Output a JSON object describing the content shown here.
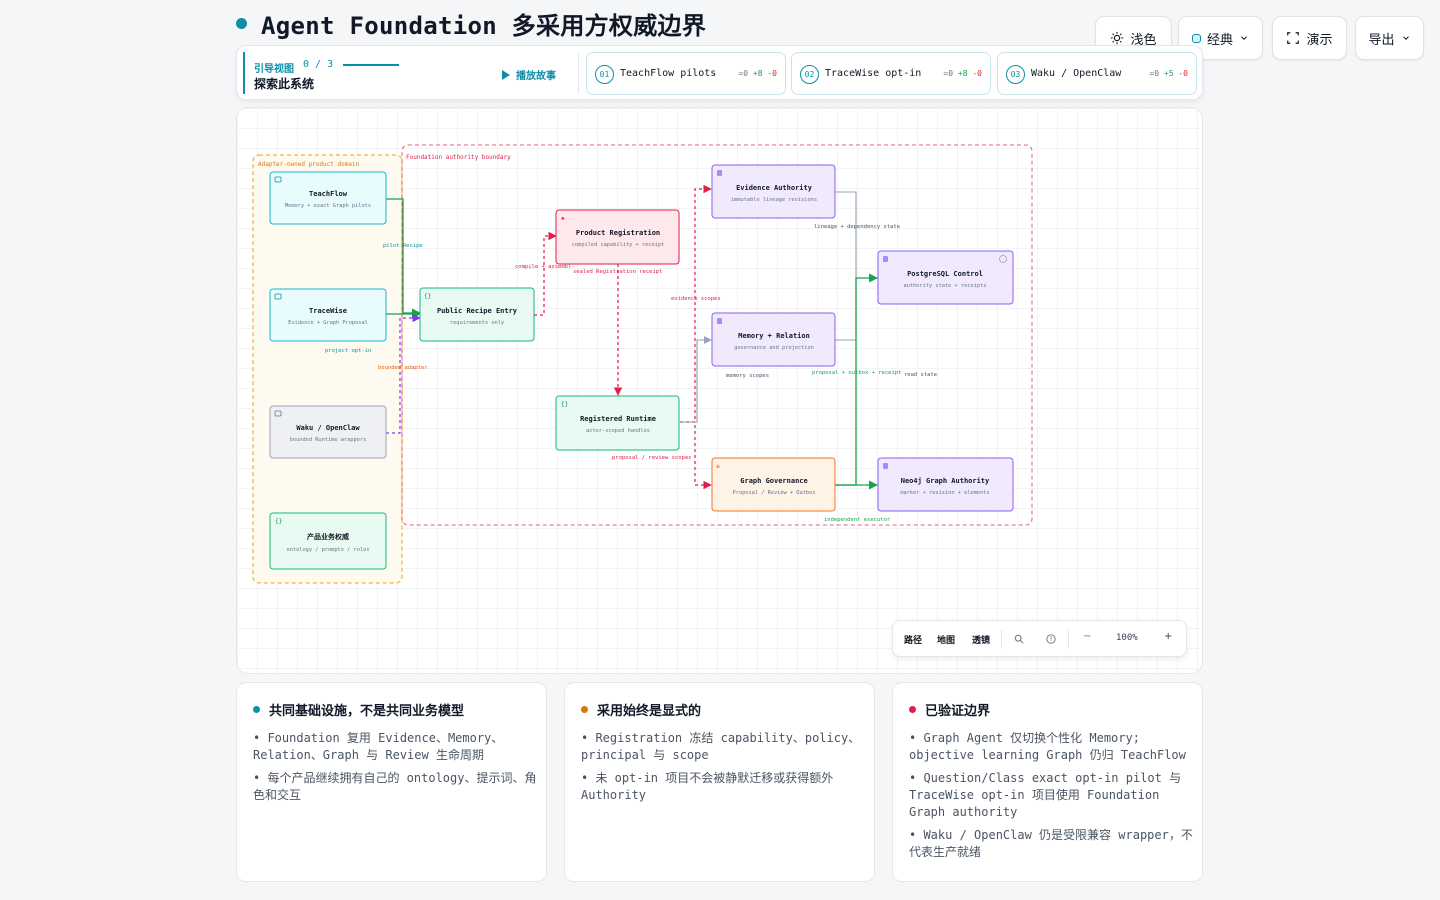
{
  "header": {
    "title": "Agent Foundation 多采用方权威边界",
    "accent": "#0e8fa7"
  },
  "top_buttons": {
    "theme": "浅色",
    "style": "经典",
    "present": "演示",
    "export": "导出"
  },
  "guide": {
    "label": "引导视图",
    "progress": "0 / 3",
    "subtitle": "探索此系统",
    "play": "播放故事",
    "steps": [
      {
        "num": "01",
        "name": "TeachFlow pilots",
        "eq": "=0",
        "add": "+8",
        "rm": "-0"
      },
      {
        "num": "02",
        "name": "TraceWise opt-in",
        "eq": "=0",
        "add": "+8",
        "rm": "-0"
      },
      {
        "num": "03",
        "name": "Waku / OpenClaw",
        "eq": "=0",
        "add": "+5",
        "rm": "-0"
      }
    ]
  },
  "diagram": {
    "groups": {
      "adapter": "Adapter-owned product domain",
      "foundation": "Foundation authority boundary"
    },
    "nodes": {
      "teachflow": {
        "title": "TeachFlow",
        "sub": "Memory + exact Graph pilots"
      },
      "tracewise": {
        "title": "TraceWise",
        "sub": "Evidence + Graph Proposal"
      },
      "waku": {
        "title": "Waku / OpenClaw",
        "sub": "bounded Runtime wrappers"
      },
      "product_auth": {
        "title": "产品业务权威",
        "sub": "ontology / prompts / roles"
      },
      "recipe": {
        "title": "Public Recipe Entry",
        "sub": "requirements only"
      },
      "registration": {
        "title": "Product Registration",
        "sub": "compiled capability + receipt"
      },
      "runtime": {
        "title": "Registered Runtime",
        "sub": "actor-scoped handles"
      },
      "evidence": {
        "title": "Evidence Authority",
        "sub": "immutable lineage revisions"
      },
      "memory": {
        "title": "Memory + Relation",
        "sub": "governance and projection"
      },
      "governance": {
        "title": "Graph Governance",
        "sub": "Proposal / Review + Outbox"
      },
      "postgres": {
        "title": "PostgreSQL Control",
        "sub": "authority state + receipts"
      },
      "neo4j": {
        "title": "Neo4j Graph Authority",
        "sub": "marker + revision + elements"
      }
    },
    "edges": {
      "pilot_recipe": "pilot Recipe",
      "project_optin": "project opt-in",
      "bounded_adapter": "bounded adapter",
      "compile_assemble": "compile + assembl-",
      "sealed_receipt": "sealed Registration receipt",
      "evidence_scopes": "evidence scopes",
      "proposal_review": "proposal / review scopes",
      "lineage_state": "lineage + dependency state",
      "memory_scopes": "memory scopes",
      "proposal_outbox": "proposal + outbox + receipt",
      "read_state": "read state",
      "independent_executor": "independent executor"
    }
  },
  "toolbar": {
    "path": "路径",
    "map": "地图",
    "lens": "透镜",
    "zoom": "100%",
    "minus": "−",
    "plus": "+"
  },
  "cards": [
    {
      "title": "共同基础设施，不是共同业务模型",
      "color": "#0e8fa7",
      "items": [
        "• Foundation 复用 Evidence、Memory、Relation、Graph 与 Review 生命周期",
        "• 每个产品继续拥有自己的 ontology、提示词、角色和交互"
      ]
    },
    {
      "title": "采用始终是显式的",
      "color": "#d97706",
      "items": [
        "• Registration 冻结 capability、policy、principal 与 scope",
        "• 未 opt-in 项目不会被静默迁移或获得额外 Authority"
      ]
    },
    {
      "title": "已验证边界",
      "color": "#e11d48",
      "items": [
        "• Graph Agent 仅切换个性化 Memory; objective learning Graph 仍归 TeachFlow",
        "• Question/Class exact opt-in pilot 与 TraceWise opt-in 项目使用 Foundation Graph authority",
        "• Waku / OpenClaw 仍是受限兼容 wrapper，不代表生产就绪"
      ]
    }
  ]
}
